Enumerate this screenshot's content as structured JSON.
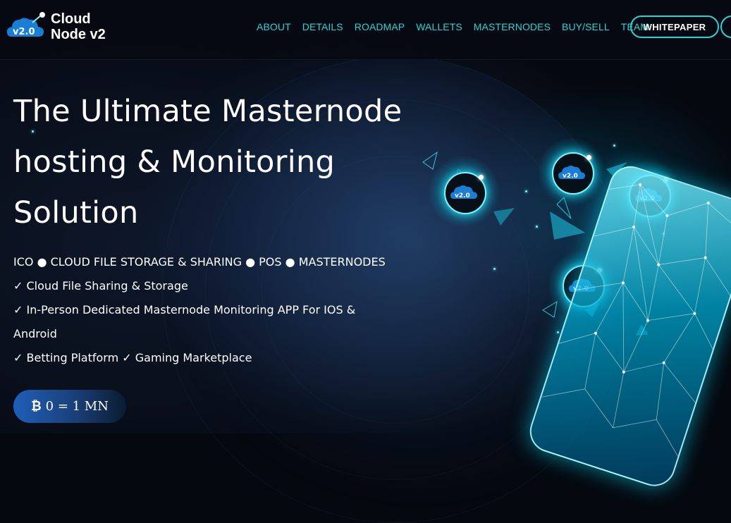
{
  "brand": {
    "line1": "Cloud",
    "line2": "Node v2",
    "logo_text": "v2.0"
  },
  "nav": {
    "items": [
      "ABOUT",
      "DETAILS",
      "ROADMAP",
      "WALLETS",
      "MASTERNODES",
      "BUY/SELL",
      "TEAM"
    ],
    "whitepaper_label": "WHITEPAPER"
  },
  "hero": {
    "title_lines": [
      "The Ultimate Masternode",
      "hosting & Monitoring",
      "Solution"
    ],
    "features": [
      "ICO ● CLOUD FILE STORAGE & SHARING ● POS ● MASTERNODES",
      "✓ Cloud File Sharing & Storage",
      "✓ In-Person Dedicated Masternode Monitoring APP For IOS & Android",
      "✓ Betting Platform ✓ Gaming Marketplace"
    ],
    "price_pill": {
      "icon": "₿",
      "text": "0 = 1 MN"
    }
  },
  "icons": [
    "cloud-logo-icon",
    "bitcoin-icon",
    "cloud-node-icon"
  ],
  "colors": {
    "accent": "#22d6d6",
    "background": "#05080f",
    "pill_blue": "#1f5fb8",
    "phone_cyan": "#33e6ff"
  }
}
